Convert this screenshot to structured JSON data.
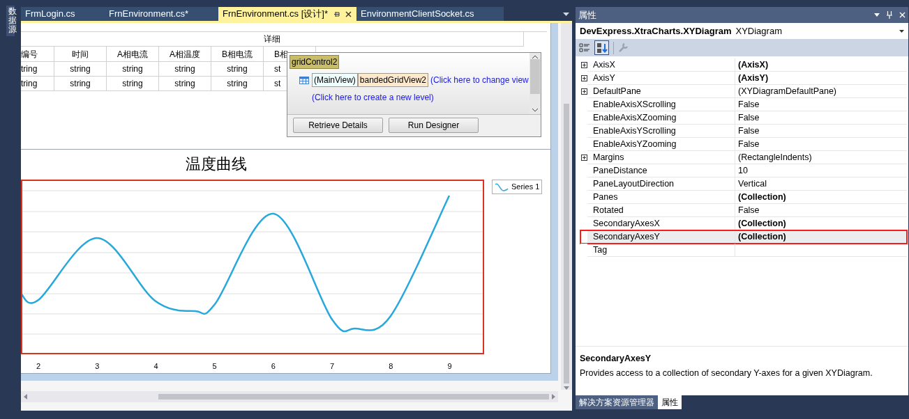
{
  "side_tab": {
    "label": "数据源"
  },
  "doc_tabs": [
    {
      "label": "FrmLogin.cs",
      "selected": false
    },
    {
      "label": "FrnEnvironment.cs*",
      "selected": false
    },
    {
      "label": "FrnEnvironment.cs [设计]*",
      "selected": true
    },
    {
      "label": "EnvironmentClientSocket.cs",
      "selected": false
    }
  ],
  "grid": {
    "band": "详细",
    "columns": [
      "编号",
      "时间",
      "A相电流",
      "A相温度",
      "B相电流",
      "B相"
    ],
    "rows": [
      [
        "tring",
        "string",
        "string",
        "string",
        "string",
        "st"
      ],
      [
        "tring",
        "string",
        "string",
        "string",
        "string",
        "st"
      ]
    ]
  },
  "smart_tag": {
    "title": "gridControl2",
    "main_view": "(MainView)",
    "view_name": "bandedGridView2",
    "change_link": "(Click here to change view",
    "create_link": "(Click here to create a new level)",
    "buttons": [
      "Retrieve Details",
      "Run Designer"
    ]
  },
  "chart": {
    "title": "温度曲线",
    "legend": "Series 1",
    "x_labels": [
      "2",
      "3",
      "4",
      "5",
      "6",
      "7",
      "8",
      "9"
    ]
  },
  "properties": {
    "title": "属性",
    "object_name": "DevExpress.XtraCharts.XYDiagram",
    "object_type": "XYDiagram",
    "rows": [
      {
        "name": "AxisX",
        "value": "(AxisX)",
        "bold": true,
        "expandable": true,
        "selected": false
      },
      {
        "name": "AxisY",
        "value": "(AxisY)",
        "bold": true,
        "expandable": true,
        "selected": false
      },
      {
        "name": "DefaultPane",
        "value": "(XYDiagramDefaultPane)",
        "bold": false,
        "expandable": true,
        "selected": false
      },
      {
        "name": "EnableAxisXScrolling",
        "value": "False",
        "bold": false,
        "expandable": false,
        "selected": false
      },
      {
        "name": "EnableAxisXZooming",
        "value": "False",
        "bold": false,
        "expandable": false,
        "selected": false
      },
      {
        "name": "EnableAxisYScrolling",
        "value": "False",
        "bold": false,
        "expandable": false,
        "selected": false
      },
      {
        "name": "EnableAxisYZooming",
        "value": "False",
        "bold": false,
        "expandable": false,
        "selected": false
      },
      {
        "name": "Margins",
        "value": "(RectangleIndents)",
        "bold": false,
        "expandable": true,
        "selected": false
      },
      {
        "name": "PaneDistance",
        "value": "10",
        "bold": false,
        "expandable": false,
        "selected": false
      },
      {
        "name": "PaneLayoutDirection",
        "value": "Vertical",
        "bold": false,
        "expandable": false,
        "selected": false
      },
      {
        "name": "Panes",
        "value": "(Collection)",
        "bold": true,
        "expandable": false,
        "selected": false
      },
      {
        "name": "Rotated",
        "value": "False",
        "bold": false,
        "expandable": false,
        "selected": false
      },
      {
        "name": "SecondaryAxesX",
        "value": "(Collection)",
        "bold": true,
        "expandable": false,
        "selected": false
      },
      {
        "name": "SecondaryAxesY",
        "value": "(Collection)",
        "bold": true,
        "expandable": false,
        "selected": true
      },
      {
        "name": "Tag",
        "expandable": false,
        "selected": false
      }
    ],
    "description": {
      "title": "SecondaryAxesY",
      "text": "Provides access to a collection of secondary Y-axes for a given XYDiagram."
    }
  },
  "bottom_tabs": [
    {
      "label": "解决方案资源管理器",
      "selected": false
    },
    {
      "label": "属性",
      "selected": true
    }
  ]
}
